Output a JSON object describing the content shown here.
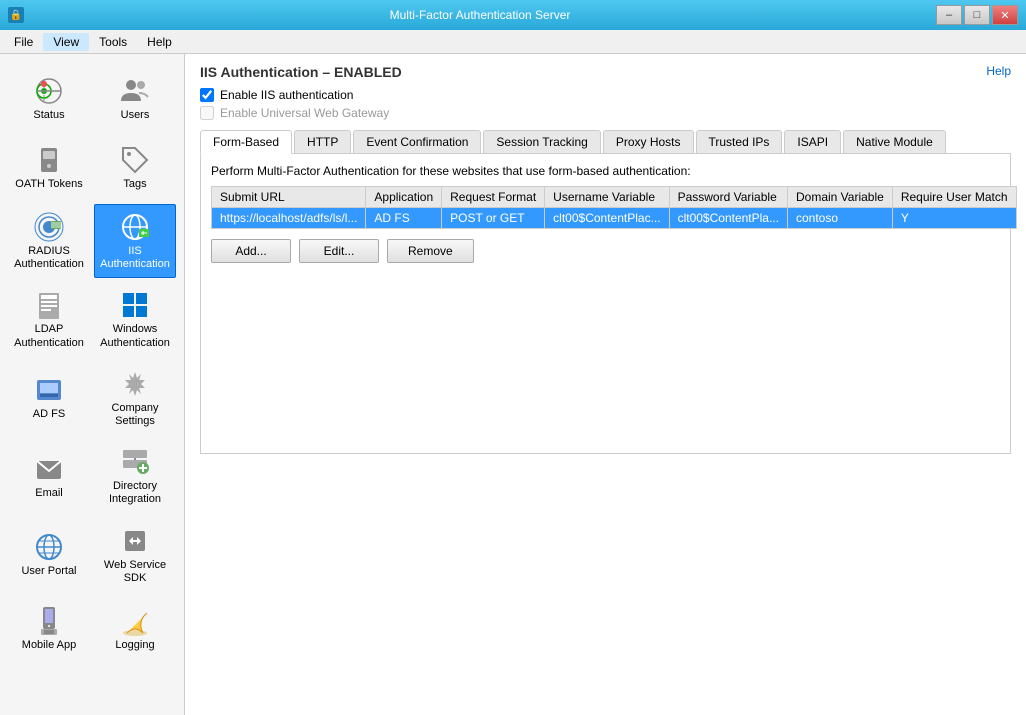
{
  "titlebar": {
    "title": "Multi-Factor Authentication Server",
    "min_label": "–",
    "max_label": "□",
    "close_label": "✕"
  },
  "menubar": {
    "items": [
      {
        "id": "file",
        "label": "File"
      },
      {
        "id": "view",
        "label": "View"
      },
      {
        "id": "tools",
        "label": "Tools"
      },
      {
        "id": "help",
        "label": "Help"
      }
    ]
  },
  "sidebar": {
    "items": [
      {
        "id": "status",
        "label": "Status",
        "icon": "status"
      },
      {
        "id": "users",
        "label": "Users",
        "icon": "users"
      },
      {
        "id": "oath-tokens",
        "label": "OATH Tokens",
        "icon": "oath"
      },
      {
        "id": "tags",
        "label": "Tags",
        "icon": "tags"
      },
      {
        "id": "radius-auth",
        "label": "RADIUS Authentication",
        "icon": "radius"
      },
      {
        "id": "iis-auth",
        "label": "IIS Authentication",
        "icon": "iis",
        "active": true
      },
      {
        "id": "ldap-auth",
        "label": "LDAP Authentication",
        "icon": "ldap"
      },
      {
        "id": "windows-auth",
        "label": "Windows Authentication",
        "icon": "windows"
      },
      {
        "id": "ad-fs",
        "label": "AD FS",
        "icon": "adfs"
      },
      {
        "id": "company-settings",
        "label": "Company Settings",
        "icon": "company"
      },
      {
        "id": "email",
        "label": "Email",
        "icon": "email"
      },
      {
        "id": "directory-integration",
        "label": "Directory Integration",
        "icon": "directory"
      },
      {
        "id": "user-portal",
        "label": "User Portal",
        "icon": "portal"
      },
      {
        "id": "web-service-sdk",
        "label": "Web Service SDK",
        "icon": "sdk"
      },
      {
        "id": "mobile-app",
        "label": "Mobile App",
        "icon": "mobile"
      },
      {
        "id": "logging",
        "label": "Logging",
        "icon": "logging"
      }
    ]
  },
  "content": {
    "title": "IIS Authentication – ENABLED",
    "help_label": "Help",
    "enable_checkbox_label": "Enable IIS authentication",
    "enable_checkbox_checked": true,
    "gateway_checkbox_label": "Enable Universal Web Gateway",
    "gateway_checkbox_checked": false,
    "gateway_checkbox_disabled": true,
    "tabs": [
      {
        "id": "form-based",
        "label": "Form-Based",
        "active": true
      },
      {
        "id": "http",
        "label": "HTTP"
      },
      {
        "id": "event-confirmation",
        "label": "Event Confirmation"
      },
      {
        "id": "session-tracking",
        "label": "Session Tracking"
      },
      {
        "id": "proxy-hosts",
        "label": "Proxy Hosts"
      },
      {
        "id": "trusted-ips",
        "label": "Trusted IPs"
      },
      {
        "id": "isapi",
        "label": "ISAPI"
      },
      {
        "id": "native-module",
        "label": "Native Module"
      }
    ],
    "tab_description": "Perform Multi-Factor Authentication for these websites that use form-based authentication:",
    "table": {
      "columns": [
        {
          "id": "submit-url",
          "label": "Submit URL"
        },
        {
          "id": "application",
          "label": "Application"
        },
        {
          "id": "request-format",
          "label": "Request Format"
        },
        {
          "id": "username-variable",
          "label": "Username Variable"
        },
        {
          "id": "password-variable",
          "label": "Password Variable"
        },
        {
          "id": "domain-variable",
          "label": "Domain Variable"
        },
        {
          "id": "require-user-match",
          "label": "Require User Match"
        }
      ],
      "rows": [
        {
          "submit_url": "https://localhost/adfs/ls/l...",
          "application": "AD FS",
          "request_format": "POST or GET",
          "username_variable": "clt00$ContentPlac...",
          "password_variable": "clt00$ContentPla...",
          "domain_variable": "contoso",
          "require_user_match": "Y",
          "selected": true
        }
      ]
    },
    "buttons": {
      "add_label": "Add...",
      "edit_label": "Edit...",
      "remove_label": "Remove"
    }
  }
}
